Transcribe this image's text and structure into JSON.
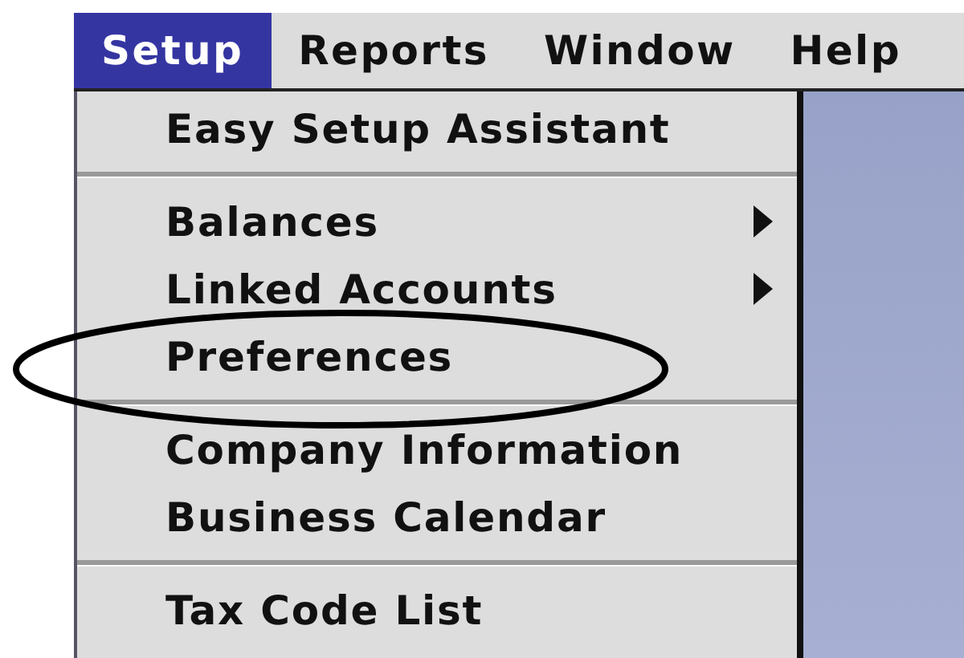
{
  "menu_bar": [
    {
      "label": "Setup",
      "selected": true
    },
    {
      "label": "Reports",
      "selected": false
    },
    {
      "label": "Window",
      "selected": false
    },
    {
      "label": "Help",
      "selected": false
    }
  ],
  "menu": {
    "items": [
      {
        "kind": "item",
        "label": "Easy Setup Assistant",
        "submenu": false
      },
      {
        "kind": "separator"
      },
      {
        "kind": "item",
        "label": "Balances",
        "submenu": true
      },
      {
        "kind": "item",
        "label": "Linked Accounts",
        "submenu": true
      },
      {
        "kind": "item",
        "label": "Preferences",
        "submenu": false,
        "circled": true
      },
      {
        "kind": "separator"
      },
      {
        "kind": "item",
        "label": "Company Information",
        "submenu": false
      },
      {
        "kind": "item",
        "label": "Business Calendar",
        "submenu": false
      },
      {
        "kind": "separator"
      },
      {
        "kind": "item",
        "label": "Tax Code List",
        "submenu": false
      }
    ]
  }
}
